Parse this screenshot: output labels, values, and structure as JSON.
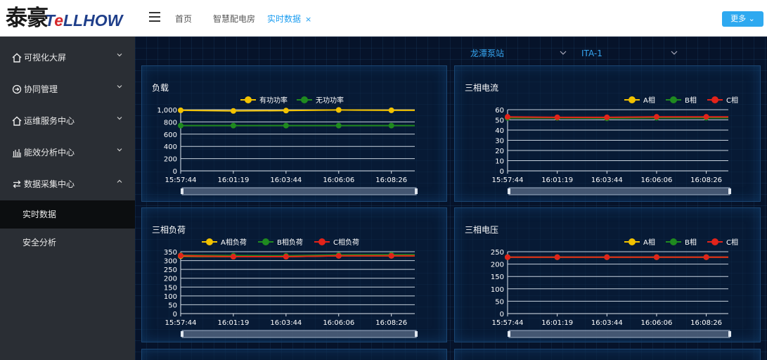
{
  "header": {
    "logo_cn": "泰豪",
    "logo_en_1": "T",
    "logo_en_2": "e",
    "logo_en_3": "LLHOW",
    "tabs": [
      {
        "label": "首页"
      },
      {
        "label": "智慧配电房"
      },
      {
        "label": "实时数据",
        "close": "×"
      }
    ],
    "more_label": "更多"
  },
  "sidebar": {
    "items": [
      {
        "label": "可视化大屏",
        "icon": "home-icon"
      },
      {
        "label": "协同管理",
        "icon": "circle-arrow-icon"
      },
      {
        "label": "运维服务中心",
        "icon": "home-icon"
      },
      {
        "label": "能效分析中心",
        "icon": "bar-chart-icon"
      },
      {
        "label": "数据采集中心",
        "icon": "swap-icon"
      }
    ],
    "subitems": [
      {
        "label": "实时数据"
      },
      {
        "label": "安全分析"
      }
    ]
  },
  "selectors": {
    "station": "龙潭泵站",
    "device": "ITA-1"
  },
  "colors": {
    "accent": "#2ea9f0",
    "series_yellow": "#f2c200",
    "series_green": "#1f8a1f",
    "series_red": "#e2231a"
  },
  "chart_data": [
    {
      "type": "line",
      "title": "负载",
      "x": [
        "15:57:44",
        "16:01:19",
        "16:03:44",
        "16:06:06",
        "16:08:26"
      ],
      "series": [
        {
          "name": "有功功率",
          "color": "#f2c200",
          "values": [
            990,
            980,
            985,
            995,
            990
          ]
        },
        {
          "name": "无功功率",
          "color": "#1f8a1f",
          "values": [
            740,
            740,
            740,
            740,
            740
          ]
        }
      ],
      "ylim": [
        0,
        1000
      ],
      "yticks": [
        "1,000",
        "800",
        "600",
        "400",
        "200",
        "0"
      ],
      "legend": "top-center",
      "grid": true
    },
    {
      "type": "line",
      "title": "三相电流",
      "x": [
        "15:57:44",
        "16:01:19",
        "16:03:44",
        "16:06:06",
        "16:08:26"
      ],
      "series": [
        {
          "name": "A相",
          "color": "#f2c200",
          "values": [
            52,
            52,
            52,
            52.5,
            52.5
          ]
        },
        {
          "name": "B相",
          "color": "#1f8a1f",
          "values": [
            52,
            52,
            51.5,
            52,
            52
          ]
        },
        {
          "name": "C相",
          "color": "#e2231a",
          "values": [
            53,
            52.5,
            52.5,
            53,
            53
          ]
        }
      ],
      "ylim": [
        0,
        60
      ],
      "yticks": [
        "60",
        "50",
        "40",
        "30",
        "20",
        "10",
        "0"
      ],
      "legend": "top-right",
      "grid": true
    },
    {
      "type": "line",
      "title": "三相负荷",
      "x": [
        "15:57:44",
        "16:01:19",
        "16:03:44",
        "16:06:06",
        "16:08:26"
      ],
      "series": [
        {
          "name": "A相负荷",
          "color": "#f2c200",
          "values": [
            325,
            322,
            322,
            327,
            327
          ]
        },
        {
          "name": "B相负荷",
          "color": "#1f8a1f",
          "values": [
            330,
            328,
            327,
            332,
            333
          ]
        },
        {
          "name": "C相负荷",
          "color": "#e2231a",
          "values": [
            328,
            322,
            322,
            327,
            327
          ]
        }
      ],
      "ylim": [
        0,
        350
      ],
      "yticks": [
        "350",
        "300",
        "250",
        "200",
        "150",
        "100",
        "50",
        "0"
      ],
      "legend": "top-center",
      "grid": true
    },
    {
      "type": "line",
      "title": "三相电压",
      "x": [
        "15:57:44",
        "16:01:19",
        "16:03:44",
        "16:06:06",
        "16:08:26"
      ],
      "series": [
        {
          "name": "A相",
          "color": "#f2c200",
          "values": [
            228,
            228,
            228,
            228,
            228
          ]
        },
        {
          "name": "B相",
          "color": "#1f8a1f",
          "values": [
            228,
            228,
            228,
            228,
            228
          ]
        },
        {
          "name": "C相",
          "color": "#e2231a",
          "values": [
            228,
            228,
            228,
            228,
            228
          ]
        }
      ],
      "ylim": [
        0,
        250
      ],
      "yticks": [
        "250",
        "200",
        "150",
        "100",
        "50",
        "0"
      ],
      "legend": "top-right",
      "grid": true
    }
  ]
}
